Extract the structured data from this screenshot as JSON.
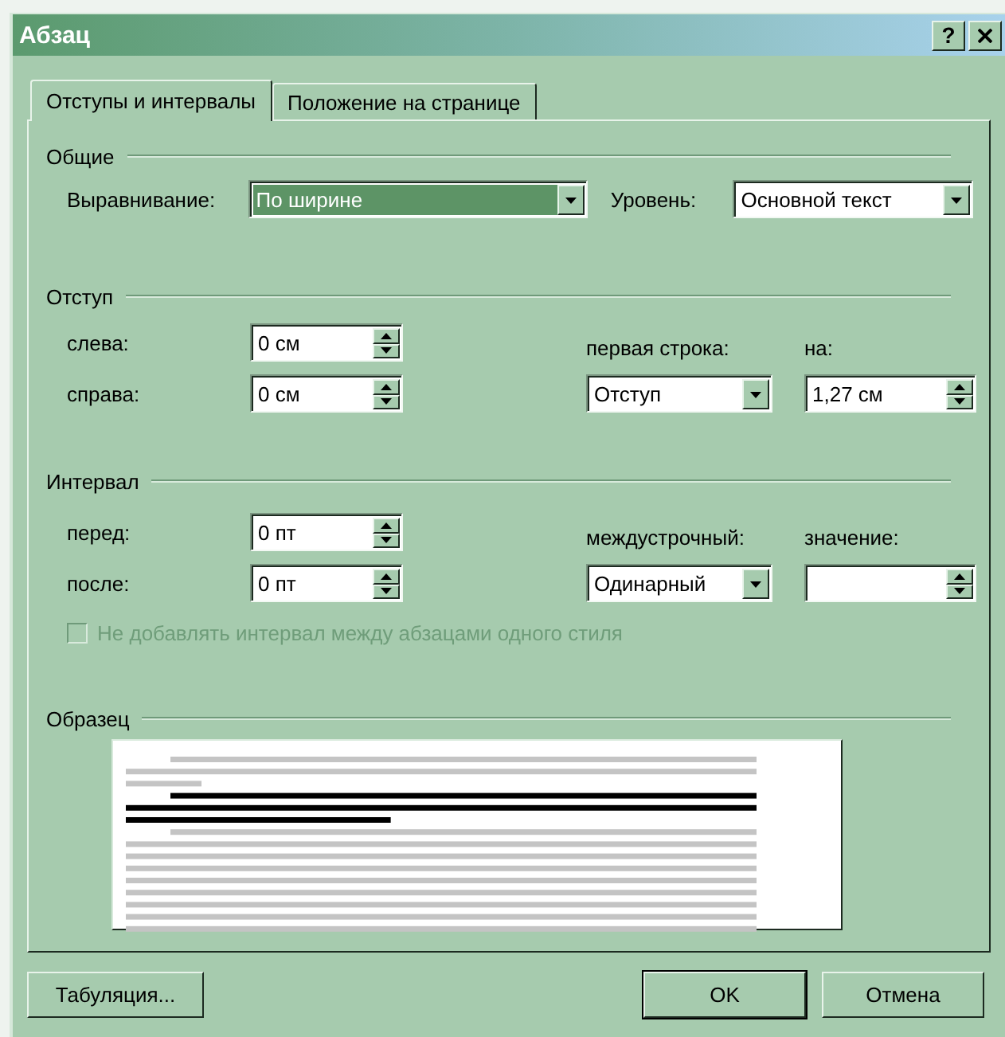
{
  "window": {
    "title": "Абзац",
    "help_label": "?"
  },
  "tabs": [
    {
      "label": "Отступы и интервалы",
      "selected": true
    },
    {
      "label": "Положение на странице",
      "selected": false
    }
  ],
  "general": {
    "heading": "Общие",
    "alignment": {
      "label": "Выравнивание:",
      "value": "По ширине",
      "highlighted": true
    },
    "outline_level": {
      "label": "Уровень:",
      "value": "Основной текст",
      "highlighted": false
    }
  },
  "indent": {
    "heading": "Отступ",
    "left": {
      "label": "слева:",
      "value": "0 см"
    },
    "right": {
      "label": "справа:",
      "value": "0 см"
    },
    "first_line": {
      "label": "первая строка:",
      "value": "Отступ",
      "highlighted": false
    },
    "by": {
      "label": "на:",
      "value": "1,27 см"
    }
  },
  "spacing": {
    "heading": "Интервал",
    "before": {
      "label": "перед:",
      "value": "0 пт"
    },
    "after": {
      "label": "после:",
      "value": "0 пт"
    },
    "line_spacing": {
      "label": "междустрочный:",
      "value": "Одинарный",
      "highlighted": false
    },
    "at": {
      "label": "значение:"
    },
    "no_space_same_style": {
      "label": "Не добавлять интервал между абзацами одного стиля",
      "checked": false,
      "disabled": true
    }
  },
  "preview": {
    "heading": "Образец"
  },
  "tabs_button": {
    "label": "Табуляция..."
  },
  "buttons": [
    {
      "label": "OK",
      "default": true
    },
    {
      "label": "Отмена",
      "default": false
    }
  ]
}
